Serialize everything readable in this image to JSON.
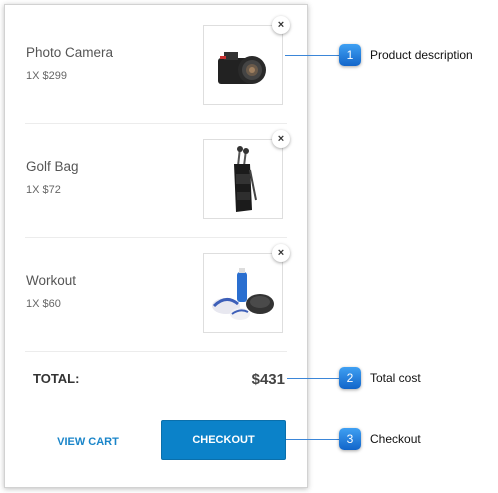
{
  "cart": {
    "items": [
      {
        "name": "Photo Camera",
        "qty": "1X $299",
        "image_icon": "camera-icon"
      },
      {
        "name": "Golf Bag",
        "qty": "1X $72",
        "image_icon": "golf-bag-icon"
      },
      {
        "name": "Workout",
        "qty": "1X $60",
        "image_icon": "workout-gear-icon"
      }
    ],
    "remove_glyph": "×",
    "total_label": "TOTAL:",
    "total_value": "$431",
    "view_cart_label": "VIEW CART",
    "checkout_label": "CHECKOUT"
  },
  "callouts": [
    {
      "number": "1",
      "text": "Product description"
    },
    {
      "number": "2",
      "text": "Total cost"
    },
    {
      "number": "3",
      "text": "Checkout"
    }
  ],
  "colors": {
    "accent": "#0b82c9",
    "callout": "#1f7fe0"
  }
}
